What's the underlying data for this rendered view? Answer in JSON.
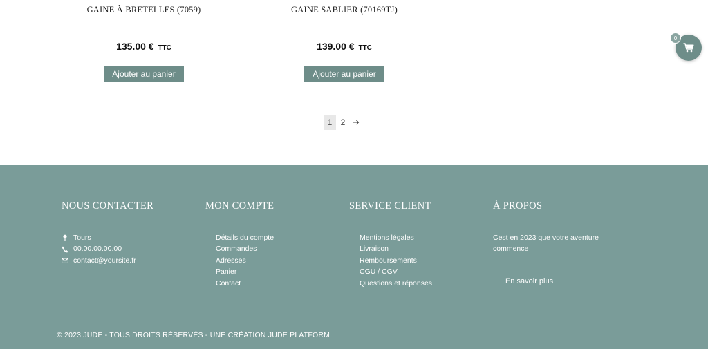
{
  "products": [
    {
      "title": "GAINE À BRETELLES (7059)",
      "price": "135.00 €",
      "price_suffix": "TTC",
      "button_label": "Ajouter au panier"
    },
    {
      "title": "GAINE SABLIER (70169TJ)",
      "price": "139.00 €",
      "price_suffix": "TTC",
      "button_label": "Ajouter au panier"
    }
  ],
  "pagination": {
    "pages": [
      "1",
      "2"
    ],
    "current": "1",
    "next_icon": "arrow-right-icon"
  },
  "cart": {
    "count": "0",
    "icon": "cart-icon"
  },
  "footer": {
    "contact": {
      "title": "NOUS CONTACTER",
      "items": [
        {
          "icon": "location-pin-icon",
          "text": "Tours"
        },
        {
          "icon": "phone-icon",
          "text": "00.00.00.00.00"
        },
        {
          "icon": "envelope-icon",
          "text": "contact@yoursite.fr"
        }
      ]
    },
    "account": {
      "title": "MON COMPTE",
      "items": [
        "Détails du compte",
        "Commandes",
        "Adresses",
        "Panier",
        "Contact"
      ]
    },
    "service": {
      "title": "SERVICE CLIENT",
      "items": [
        "Mentions légales",
        "Livraison",
        "Remboursements",
        "CGU / CGV",
        "Questions et réponses"
      ]
    },
    "about": {
      "title": "À PROPOS",
      "text": "Cest en 2023 que votre aventure commence",
      "link": "En savoir plus"
    },
    "copyright": "© 2023 JUDE - TOUS DROITS RÉSERVÉS - UNE CRÉATION JUDE PLATFORM"
  },
  "colors": {
    "accent": "#6e8d89",
    "footer_bg": "#7a9c99"
  }
}
